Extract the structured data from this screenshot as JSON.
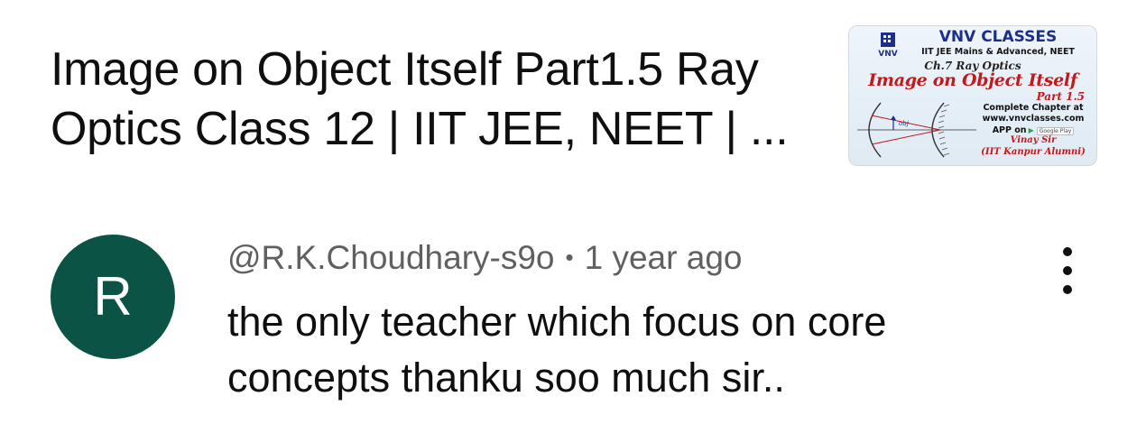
{
  "video": {
    "title": "Image on Object Itself Part1.5 Ray Optics Class 12 | IIT JEE, NEET | ...",
    "thumbnail": {
      "brand": "VNV CLASSES",
      "logo_text": "VNV",
      "subtitle": "IIT JEE Mains & Advanced, NEET",
      "chapter": "Ch.7 Ray Optics",
      "topic": "Image on Object Itself",
      "part": "Part 1.5",
      "diagram_label": "obj",
      "complete": "Complete Chapter at",
      "website": "www.vnvclasses.com",
      "app": "APP on",
      "store": "Google Play",
      "teacher": "Vinay Sir",
      "alumni": "(IIT Kanpur Alumni)"
    }
  },
  "comment": {
    "avatar_letter": "R",
    "avatar_color": "#0b5345",
    "author": "@R.K.Choudhary-s9o",
    "separator": "•",
    "time": "1 year ago",
    "text": "the only teacher which focus on core concepts thanku soo much sir..",
    "menu_icon": "more-vertical-icon"
  }
}
